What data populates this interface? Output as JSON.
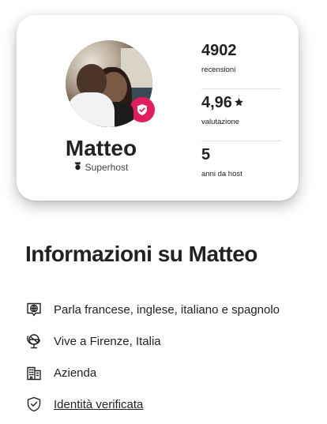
{
  "host": {
    "name": "Matteo",
    "superhost_label": "Superhost",
    "avatar_icon": "host-photo",
    "badge_icon": "verified-shield-icon"
  },
  "stats": [
    {
      "value": "4902",
      "label": "recensioni"
    },
    {
      "value": "4,96",
      "label": "valutazione",
      "icon": "star-icon"
    },
    {
      "value": "5",
      "label": "anni da host"
    }
  ],
  "section": {
    "title": "Informazioni su Matteo"
  },
  "info": [
    {
      "icon": "language-icon",
      "text": "Parla francese, inglese, italiano e spagnolo"
    },
    {
      "icon": "globe-location-icon",
      "text": "Vive a Firenze, Italia"
    },
    {
      "icon": "building-icon",
      "text": "Azienda"
    },
    {
      "icon": "shield-check-icon",
      "text": "Identità verificata"
    }
  ],
  "colors": {
    "accent": "#E31C5F",
    "text": "#222222"
  }
}
